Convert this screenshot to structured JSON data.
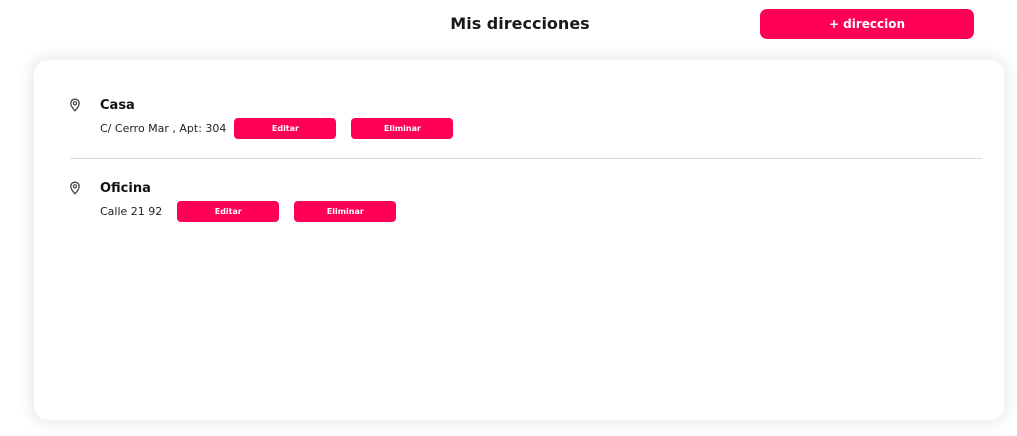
{
  "header": {
    "title": "Mis direcciones",
    "add_button_label": "+ direccion"
  },
  "addresses": [
    {
      "name": "Casa",
      "detail": "C/ Cerro Mar , Apt: 304",
      "edit_label": "Editar",
      "delete_label": "Eliminar"
    },
    {
      "name": "Oficina",
      "detail": "Calle 21 92",
      "edit_label": "Editar",
      "delete_label": "Eliminar"
    }
  ],
  "icons": {
    "address_icon": "location-pin-icon"
  },
  "colors": {
    "accent": "#ff0055",
    "divider": "#d6d6d6"
  }
}
